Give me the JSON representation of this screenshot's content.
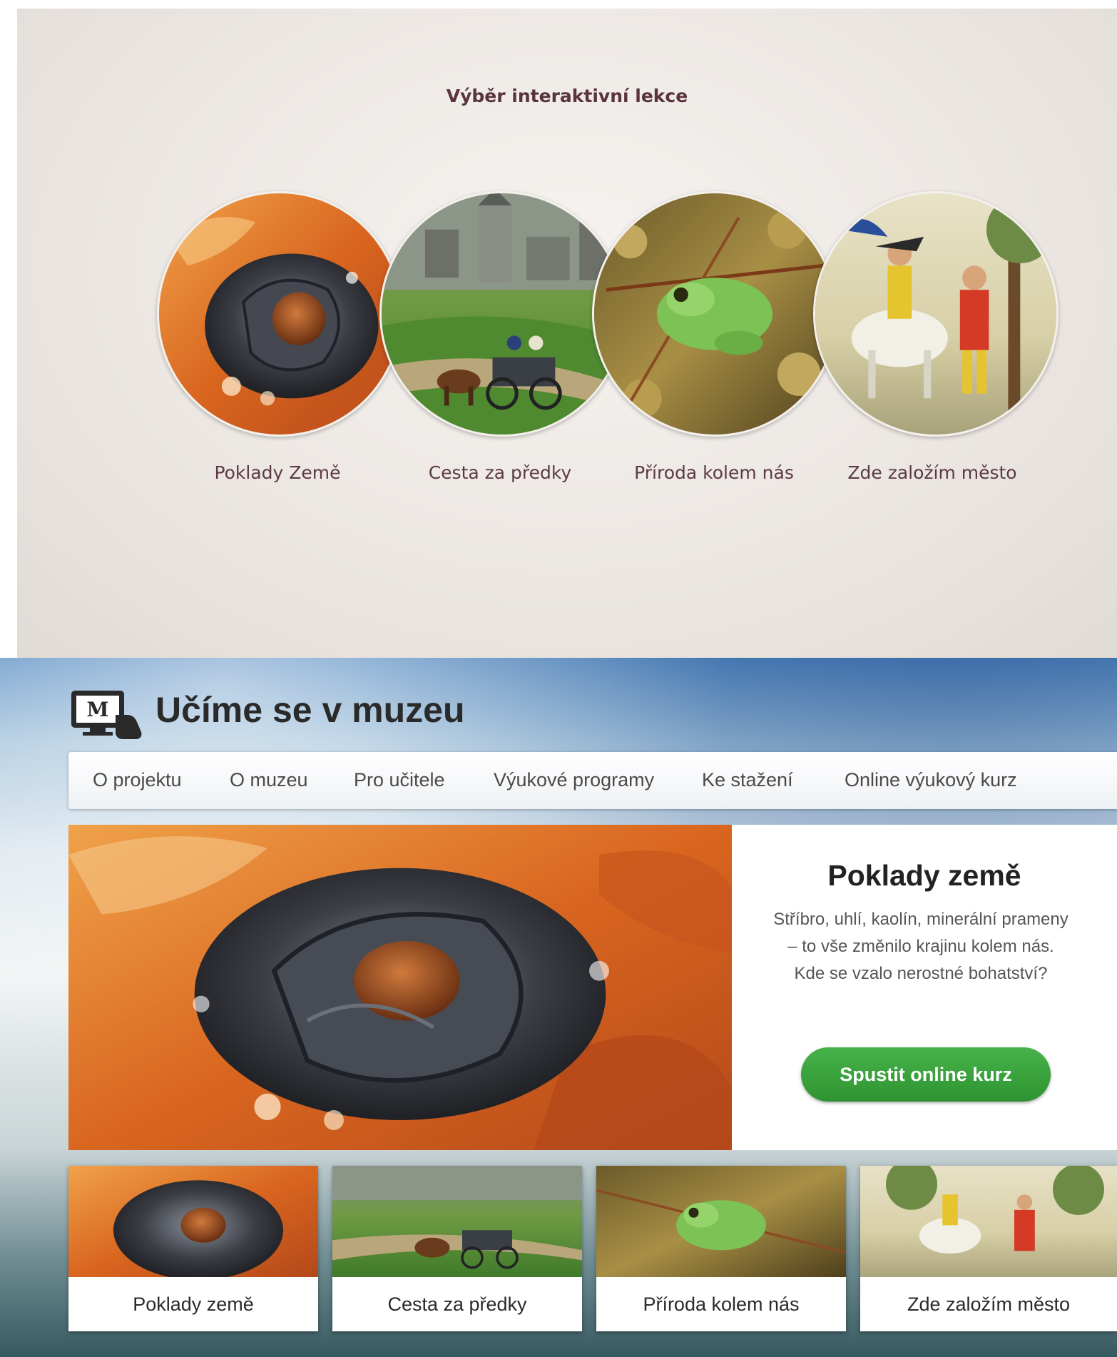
{
  "lesson_picker": {
    "title": "Výběr interaktivní lekce",
    "lessons": [
      {
        "label": "Poklady Země",
        "image": "mineral-photo"
      },
      {
        "label": "Cesta za předky",
        "image": "town-carriage-illustration"
      },
      {
        "label": "Příroda kolem nás",
        "image": "tree-frog-photo"
      },
      {
        "label": "Zde založím město",
        "image": "horseman-illustration"
      }
    ]
  },
  "site": {
    "logo_icon": "museum-monitor-hand-icon",
    "title": "Učíme se v muzeu"
  },
  "nav": {
    "items": [
      "O projektu",
      "O muzeu",
      "Pro učitele",
      "Výukové programy",
      "Ke stažení",
      "Online výukový kurz"
    ]
  },
  "hero": {
    "title": "Poklady země",
    "description": "Stříbro, uhlí, kaolín, minerální prameny – to vše změnilo krajinu kolem nás. Kde se vzalo nerostné bohatství?",
    "button_label": "Spustit online kurz",
    "button_color": "#3aa33d"
  },
  "cards": [
    {
      "label": "Poklady země"
    },
    {
      "label": "Cesta za předky"
    },
    {
      "label": "Příroda kolem nás"
    },
    {
      "label": "Zde založím město"
    }
  ]
}
